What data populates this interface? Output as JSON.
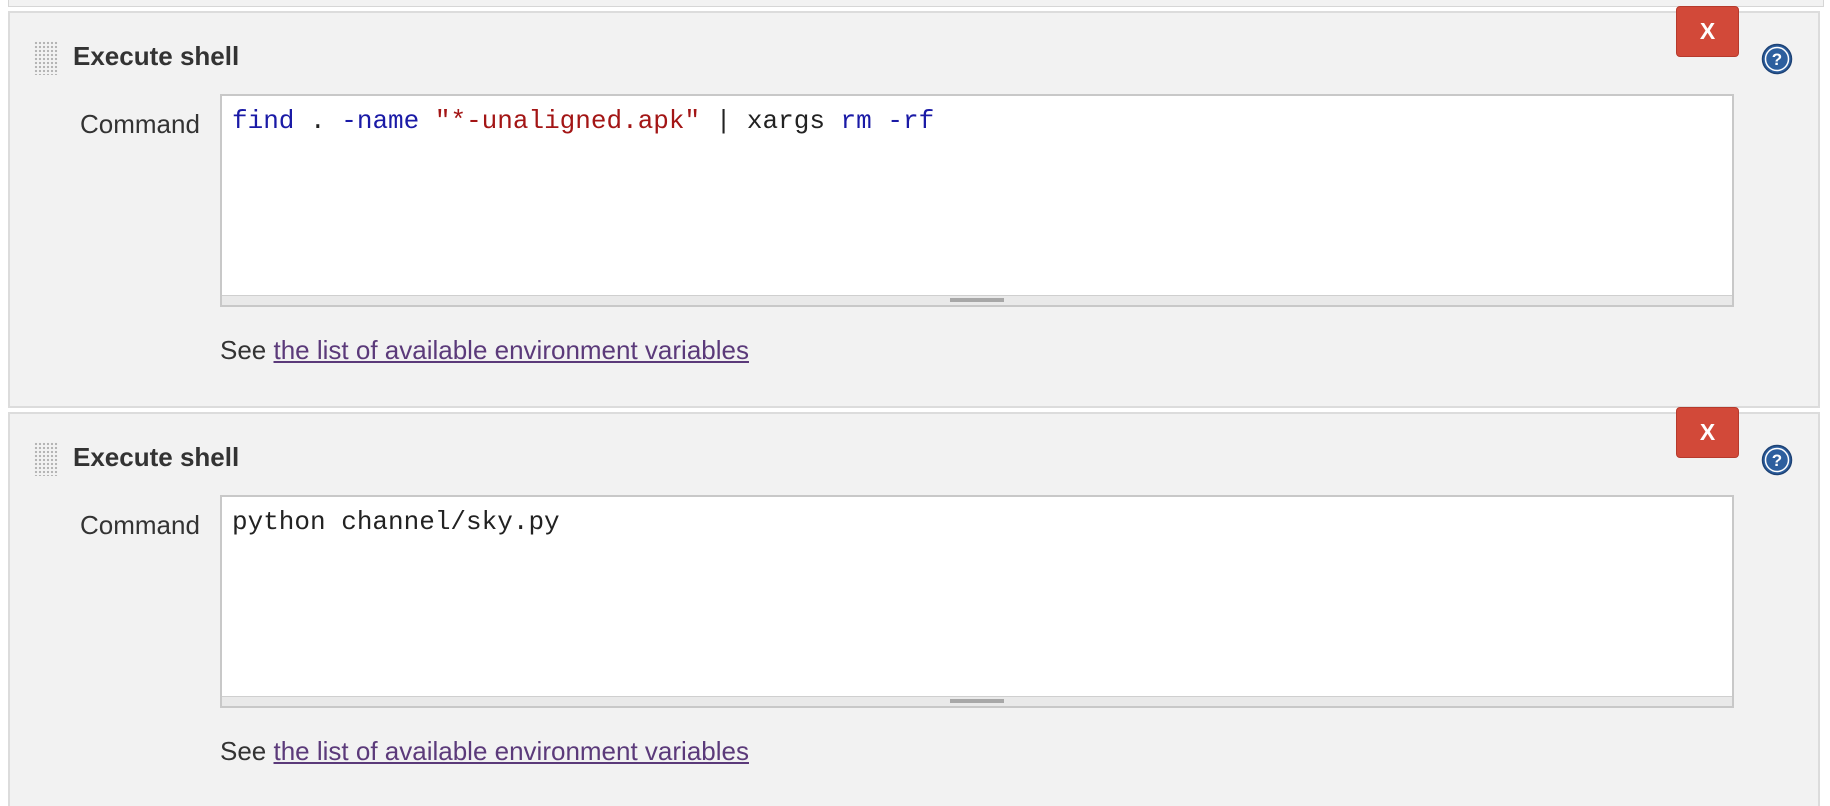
{
  "steps": [
    {
      "title": "Execute shell",
      "delete_label": "X",
      "command_label": "Command",
      "command_tokens": [
        {
          "text": "find",
          "kind": "kw"
        },
        {
          "text": " . ",
          "kind": "plain"
        },
        {
          "text": "-name",
          "kind": "kw"
        },
        {
          "text": " ",
          "kind": "plain"
        },
        {
          "text": "\"*-unaligned.apk\"",
          "kind": "str"
        },
        {
          "text": " | xargs ",
          "kind": "plain"
        },
        {
          "text": "rm",
          "kind": "kw"
        },
        {
          "text": " ",
          "kind": "plain"
        },
        {
          "text": "-rf",
          "kind": "kw"
        }
      ],
      "see_prefix": "See ",
      "see_link": "the list of available environment variables"
    },
    {
      "title": "Execute shell",
      "delete_label": "X",
      "command_label": "Command",
      "command_tokens": [
        {
          "text": "python channel/sky.py",
          "kind": "plain"
        }
      ],
      "see_prefix": "See ",
      "see_link": "the list of available environment variables"
    }
  ],
  "icons": {
    "help": "help-icon",
    "drag": "drag-handle-icon"
  },
  "colors": {
    "delete_button": "#d24939",
    "link": "#5b3a7a",
    "keyword": "#1a1aa6",
    "string": "#a31515",
    "panel_bg": "#f2f2f2"
  }
}
